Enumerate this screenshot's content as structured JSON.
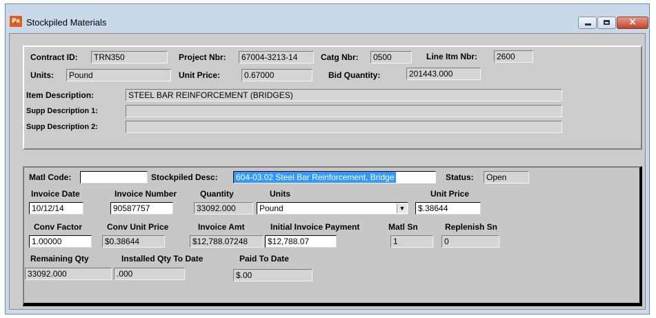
{
  "window": {
    "title": "Stockpiled Materials",
    "app_icon": "P",
    "app_icon_sub": "R",
    "controls": {
      "minimize": "minimize-icon",
      "maximize": "maximize-icon",
      "close": "×"
    }
  },
  "header": {
    "contract_id_label": "Contract ID:",
    "contract_id": "TRN350",
    "project_nbr_label": "Project Nbr:",
    "project_nbr": "67004-3213-14",
    "catg_nbr_label": "Catg Nbr:",
    "catg_nbr": "0500",
    "line_itm_nbr_label": "Line Itm Nbr:",
    "line_itm_nbr": "2600",
    "units_label": "Units:",
    "units": "Pound",
    "unit_price_label": "Unit Price:",
    "unit_price": "0.67000",
    "bid_quantity_label": "Bid Quantity:",
    "bid_quantity": "201443.000",
    "item_description_label": "Item Description:",
    "item_description": "STEEL BAR REINFORCEMENT (BRIDGES)",
    "supp_desc_1_label": "Supp Description 1:",
    "supp_desc_1": "",
    "supp_desc_2_label": "Supp Description 2:",
    "supp_desc_2": ""
  },
  "detail": {
    "matl_code_label": "Matl Code:",
    "matl_code": "",
    "stockpiled_desc_label": "Stockpiled Desc:",
    "stockpiled_desc": "604-03.02 Steel Bar Reinforcement, Bridge",
    "status_label": "Status:",
    "status": "Open",
    "invoice_date_label": "Invoice Date",
    "invoice_date": "10/12/14",
    "invoice_number_label": "Invoice Number",
    "invoice_number": "90587757",
    "quantity_label": "Quantity",
    "quantity": "33092.000",
    "units_label": "Units",
    "units": "Pound",
    "unit_price_label": "Unit Price",
    "unit_price": "$.38644",
    "conv_factor_label": "Conv Factor",
    "conv_factor": "1.00000",
    "conv_unit_price_label": "Conv Unit Price",
    "conv_unit_price": "$0.38644",
    "invoice_amt_label": "Invoice Amt",
    "invoice_amt": "$12,788.07248",
    "initial_invoice_payment_label": "Initial Invoice Payment",
    "initial_invoice_payment": "$12,788.07",
    "matl_sn_label": "Matl Sn",
    "matl_sn": "1",
    "replenish_sn_label": "Replenish Sn",
    "replenish_sn": "0",
    "remaining_qty_label": "Remaining Qty",
    "remaining_qty": "33092.000",
    "installed_qty_label": "Installed Qty To Date",
    "installed_qty": ".000",
    "paid_to_date_label": "Paid To Date",
    "paid_to_date": "$.00"
  }
}
